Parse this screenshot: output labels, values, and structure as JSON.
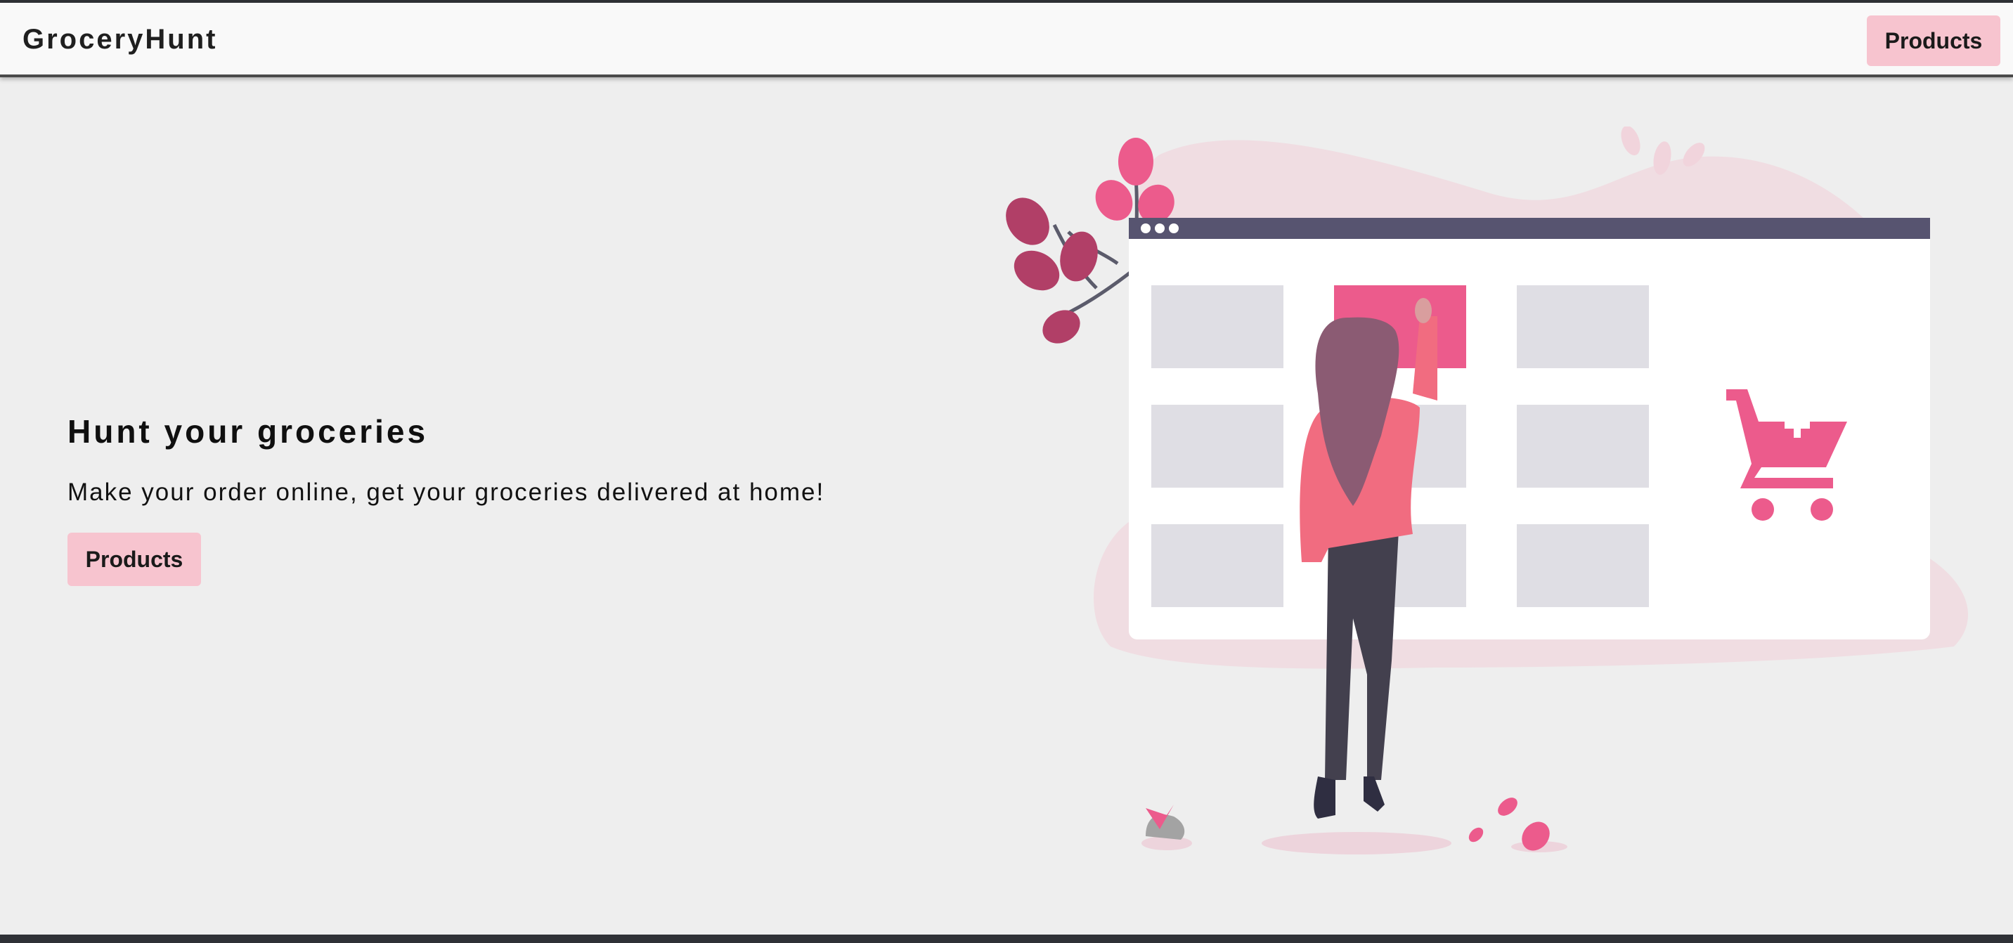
{
  "navbar": {
    "brand": "GroceryHunt",
    "products_label": "Products"
  },
  "hero": {
    "title": "Hunt your groceries",
    "subtitle": "Make your order online, get your groceries delivered at home!",
    "products_label": "Products"
  },
  "colors": {
    "accent_pink": "#f7c4cf",
    "illustration_pink": "#ec5b8c",
    "background": "#eeeeee",
    "browser_bar": "#575470"
  },
  "illustration": {
    "icon": "shopping-cart-icon"
  }
}
